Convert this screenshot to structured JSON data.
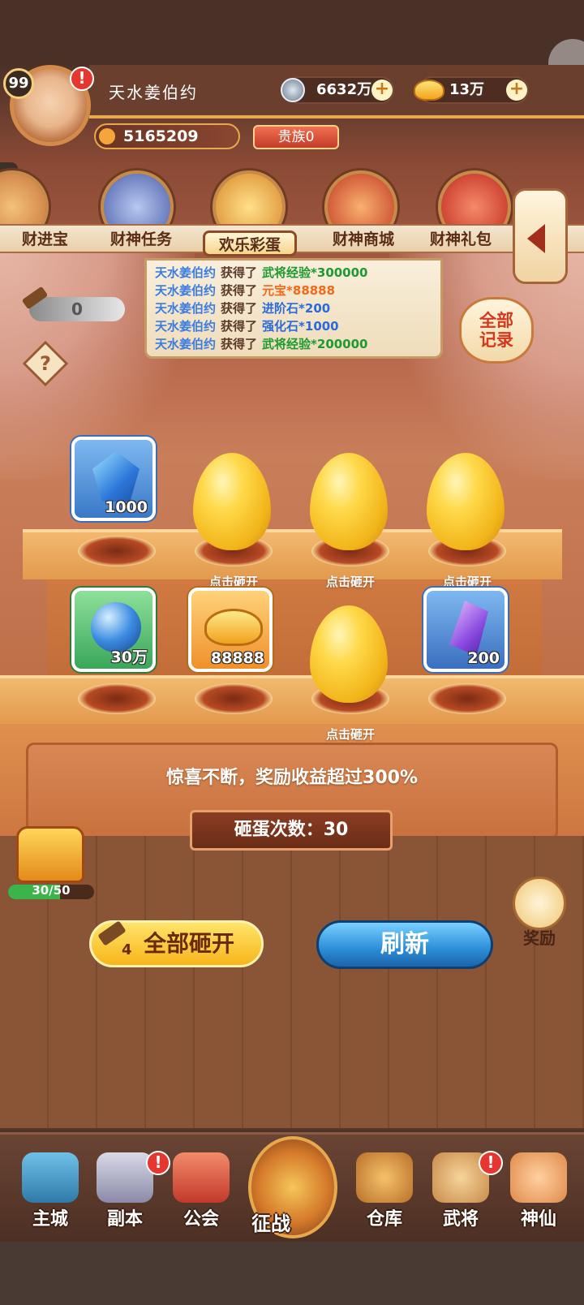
{
  "header": {
    "level": "99",
    "player_name": "天水姜伯约",
    "copper": "6632万",
    "ingot": "13万",
    "paw_points": "5165209",
    "noble": "贵族0"
  },
  "tabs": [
    {
      "label": "财进宝"
    },
    {
      "label": "财神任务"
    },
    {
      "label": "欢乐彩蛋"
    },
    {
      "label": "财神商城"
    },
    {
      "label": "财神礼包"
    }
  ],
  "ticker": [
    {
      "name": "天水姜伯约",
      "verb": "获得了",
      "reward": "武将经验*300000",
      "color": "green"
    },
    {
      "name": "天水姜伯约",
      "verb": "获得了",
      "reward": "元宝*88888",
      "color": "orange"
    },
    {
      "name": "天水姜伯约",
      "verb": "获得了",
      "reward": "进阶石*200",
      "color": "blue"
    },
    {
      "name": "天水姜伯约",
      "verb": "获得了",
      "reward": "强化石*1000",
      "color": "blue"
    },
    {
      "name": "天水姜伯约",
      "verb": "获得了",
      "reward": "武将经验*200000",
      "color": "green"
    }
  ],
  "hammer_count": "0",
  "help_symbol": "?",
  "all_records": {
    "line1": "全部",
    "line2": "记录"
  },
  "row1": [
    {
      "type": "reward",
      "value": "1000",
      "icon": "blue-crystal-icon"
    },
    {
      "type": "egg",
      "label": "点击砸开"
    },
    {
      "type": "egg",
      "label": "点击砸开"
    },
    {
      "type": "egg",
      "label": "点击砸开"
    }
  ],
  "row2": [
    {
      "type": "reward",
      "value": "30万",
      "icon": "orb-icon"
    },
    {
      "type": "reward",
      "value": "88888",
      "icon": "gold-ingot-icon"
    },
    {
      "type": "egg",
      "label": "点击砸开"
    },
    {
      "type": "reward",
      "value": "200",
      "icon": "purple-crystal-icon"
    }
  ],
  "info_text": "惊喜不断，奖励收益超过300%",
  "smash_count": "砸蛋次数：30",
  "chest_progress": {
    "label": "30/50",
    "fraction": 0.6
  },
  "buttons": {
    "smash_all": "全部砸开",
    "hammer_cost": "4",
    "refresh": "刷新",
    "reward": "奖励"
  },
  "nav": [
    "主城",
    "副本",
    "公会",
    "征战",
    "仓库",
    "武将",
    "神仙"
  ]
}
